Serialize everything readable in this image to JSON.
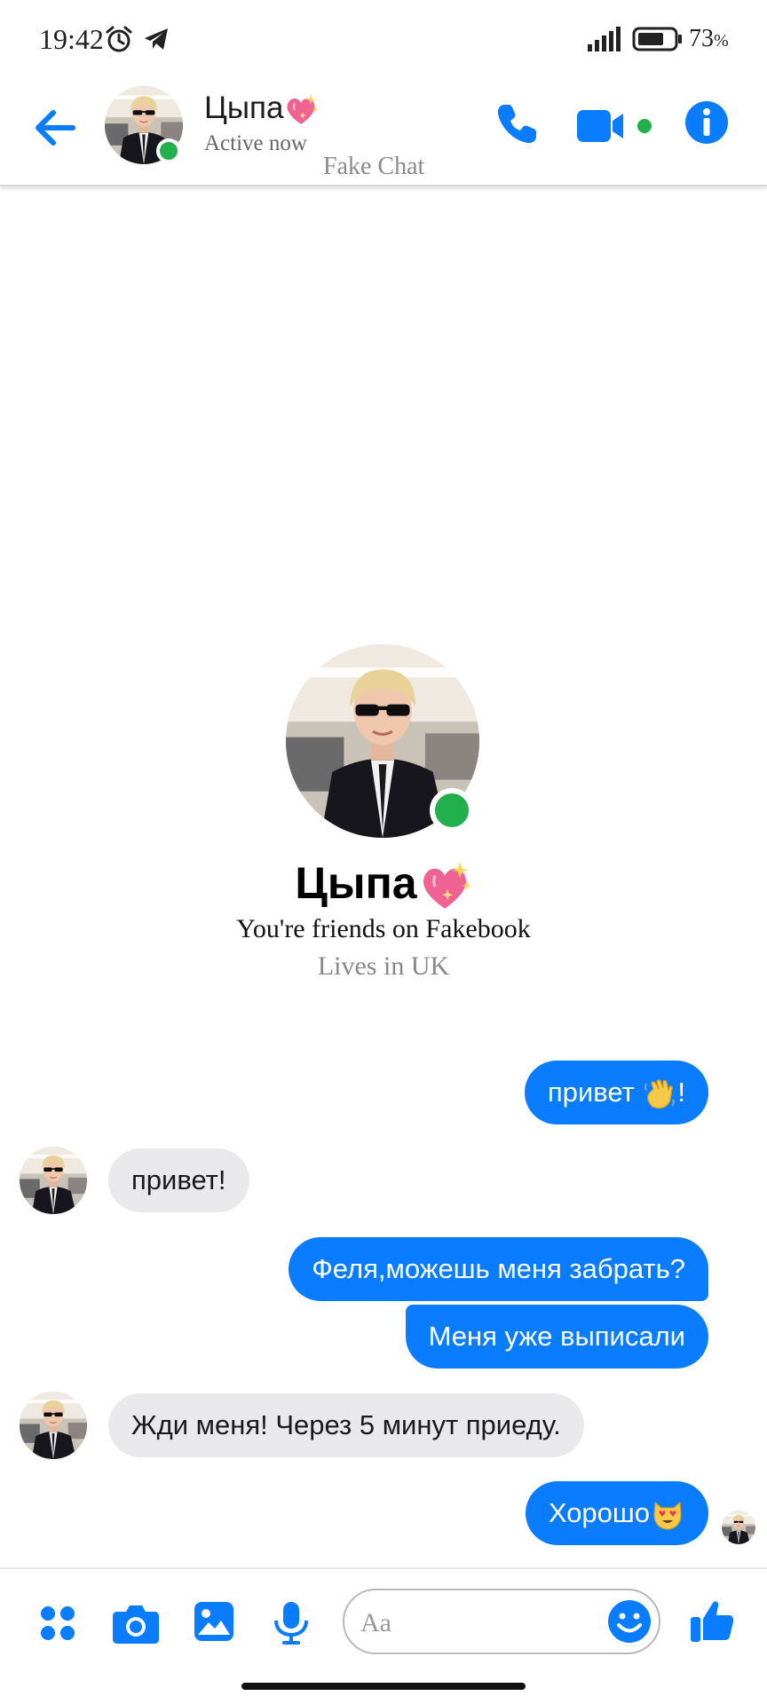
{
  "status_bar": {
    "time": "19:42",
    "battery_percent": "73",
    "battery_unit": "%",
    "icons": [
      "alarm-icon",
      "telegram-icon",
      "signal-icon",
      "battery-icon"
    ]
  },
  "header": {
    "contact_name": "Цыпа",
    "status": "Active now",
    "watermark": "Fake Chat",
    "actions": [
      "phone-icon",
      "video-camera-icon",
      "info-icon"
    ]
  },
  "profile": {
    "name": "Цыпа",
    "friends_text": "You're friends on Fakebook",
    "location": "Lives in UK"
  },
  "messages": [
    {
      "direction": "outgoing",
      "text": "привет ",
      "emoji": "waving-hand",
      "suffix": "!"
    },
    {
      "direction": "incoming",
      "text": "привет!"
    },
    {
      "direction": "outgoing",
      "text": "Феля,можешь меня забрать?"
    },
    {
      "direction": "outgoing",
      "text": "Меня уже выписали"
    },
    {
      "direction": "incoming",
      "text": "Жди меня! Через 5 минут приеду."
    },
    {
      "direction": "outgoing",
      "text": "Хорошо",
      "emoji": "heart-eyes-cat"
    }
  ],
  "composer": {
    "placeholder": "Aa",
    "icons": [
      "apps-icon",
      "camera-icon",
      "gallery-icon",
      "microphone-icon",
      "emoji-icon",
      "thumbs-up-icon"
    ]
  },
  "colors": {
    "accent": "#0a7cff",
    "online": "#21b04b",
    "incoming_bubble": "#e9e9eb",
    "sparkle_heart": "#f06292"
  }
}
